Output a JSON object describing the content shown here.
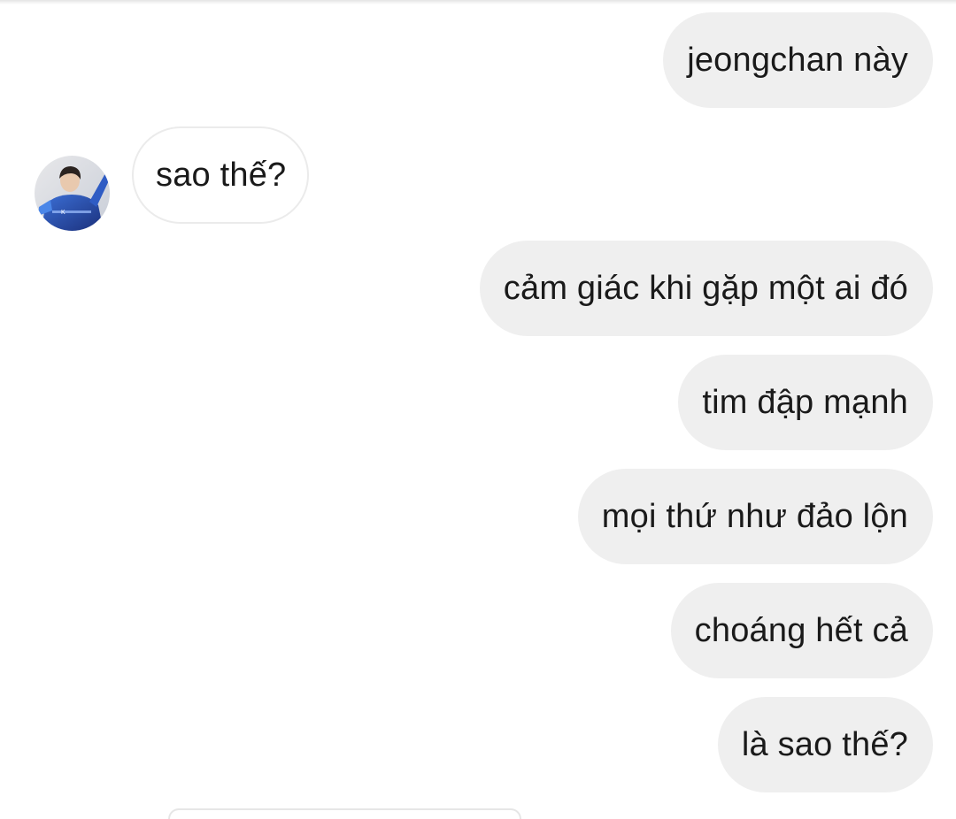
{
  "conversation": {
    "messages": [
      {
        "direction": "outgoing",
        "text": "jeongchan này"
      },
      {
        "direction": "incoming",
        "text": "sao thế?"
      },
      {
        "direction": "outgoing",
        "text": "cảm giác khi gặp một ai đó"
      },
      {
        "direction": "outgoing",
        "text": "tim đập mạnh"
      },
      {
        "direction": "outgoing",
        "text": "mọi thứ như đảo lộn"
      },
      {
        "direction": "outgoing",
        "text": "choáng hết cả"
      },
      {
        "direction": "outgoing",
        "text": "là sao thế?"
      }
    ],
    "contact_avatar": {
      "icon": "profile-photo"
    }
  },
  "colors": {
    "outgoing_bubble": "#efefef",
    "incoming_bubble": "#ffffff",
    "incoming_border": "#ebebeb",
    "text": "#1a1a1a"
  }
}
